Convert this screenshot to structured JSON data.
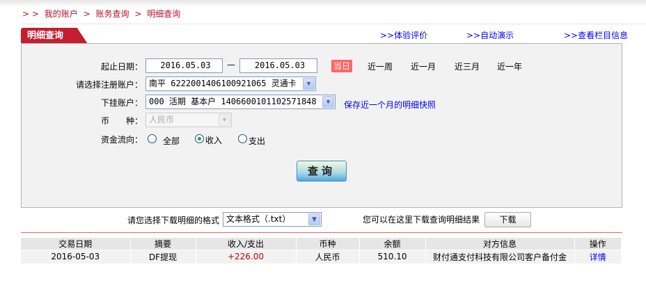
{
  "breadcrumb": [
    "> >",
    "我的账户",
    ">",
    "账务查询",
    ">",
    "明细查询"
  ],
  "tab": "明细查询",
  "top_links": [
    ">>体验评价",
    ">>自动演示",
    ">>查看栏目信息"
  ],
  "form": {
    "date_label": "起止日期：",
    "start_date": "2016.05.03",
    "dash": "—",
    "end_date": "2016.05.03",
    "quick_ranges": [
      "当日",
      "近一周",
      "近一月",
      "近三月",
      "近一年"
    ],
    "account_label": "请选择注册账户：",
    "account_value": "南平 6222001406100921065 灵通卡",
    "sub_label": "下挂账户：",
    "sub_value": "000 活期 基本户 1406600101102571848",
    "snapshot_link": "保存近一个月的明细快照",
    "currency_label": "币　　种：",
    "currency_value": "人民币",
    "direction_label": "资金流向：",
    "directions": [
      "全部",
      "收入",
      "支出"
    ],
    "direction_selected": "收入",
    "query_button": "查询"
  },
  "download": {
    "label": "请您选择下载明细的格式",
    "format": "文本格式（.txt）",
    "hint": "您可以在这里下载查询明细结果",
    "button": "下载"
  },
  "table": {
    "headers": [
      "交易日期",
      "摘要",
      "收入/支出",
      "币种",
      "余额",
      "对方信息",
      "操作"
    ],
    "rows": [
      [
        "2016-05-03",
        "DF提现",
        "+226.00",
        "人民币",
        "510.10",
        "财付通支付科技有限公司客户备付金",
        "详情"
      ]
    ]
  },
  "colors": {
    "accent": "#c41e30",
    "today": "#ff6666",
    "amount": "#c00000",
    "link": "#0000ee"
  }
}
